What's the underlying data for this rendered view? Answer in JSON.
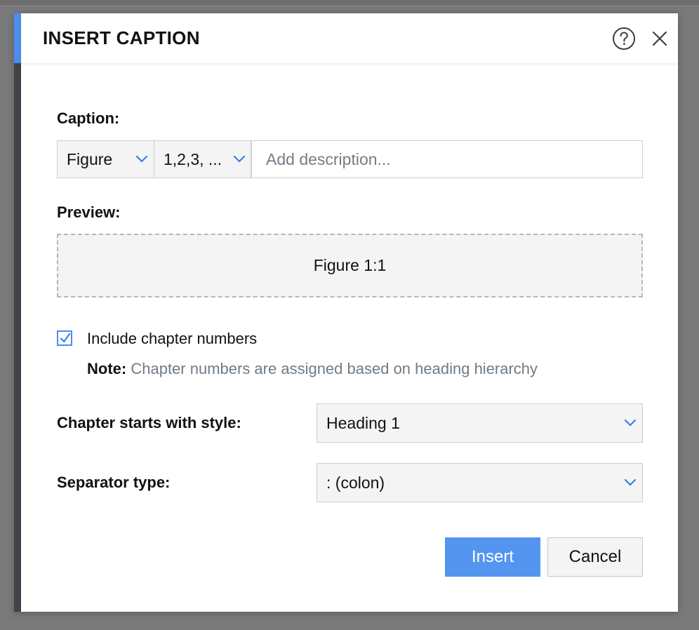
{
  "dialog": {
    "title": "INSERT CAPTION",
    "help_icon": "help-circle-icon",
    "close_icon": "close-icon"
  },
  "caption": {
    "label": "Caption:",
    "label_select": {
      "value": "Figure"
    },
    "numbering_select": {
      "value": "1,2,3, ..."
    },
    "description": {
      "value": "",
      "placeholder": "Add description..."
    }
  },
  "preview": {
    "label": "Preview:",
    "text": "Figure 1:1"
  },
  "chapter_numbers": {
    "checked": true,
    "label": "Include chapter numbers",
    "note_label": "Note:",
    "note_text": "Chapter numbers are assigned based on heading hierarchy"
  },
  "chapter_style": {
    "label": "Chapter starts with style:",
    "value": "Heading 1"
  },
  "separator": {
    "label": "Separator type:",
    "value": ": (colon)"
  },
  "buttons": {
    "insert": "Insert",
    "cancel": "Cancel"
  },
  "colors": {
    "accent": "#4a8ef0",
    "primary_button": "#5496ef",
    "note_text": "#6f7c88"
  }
}
